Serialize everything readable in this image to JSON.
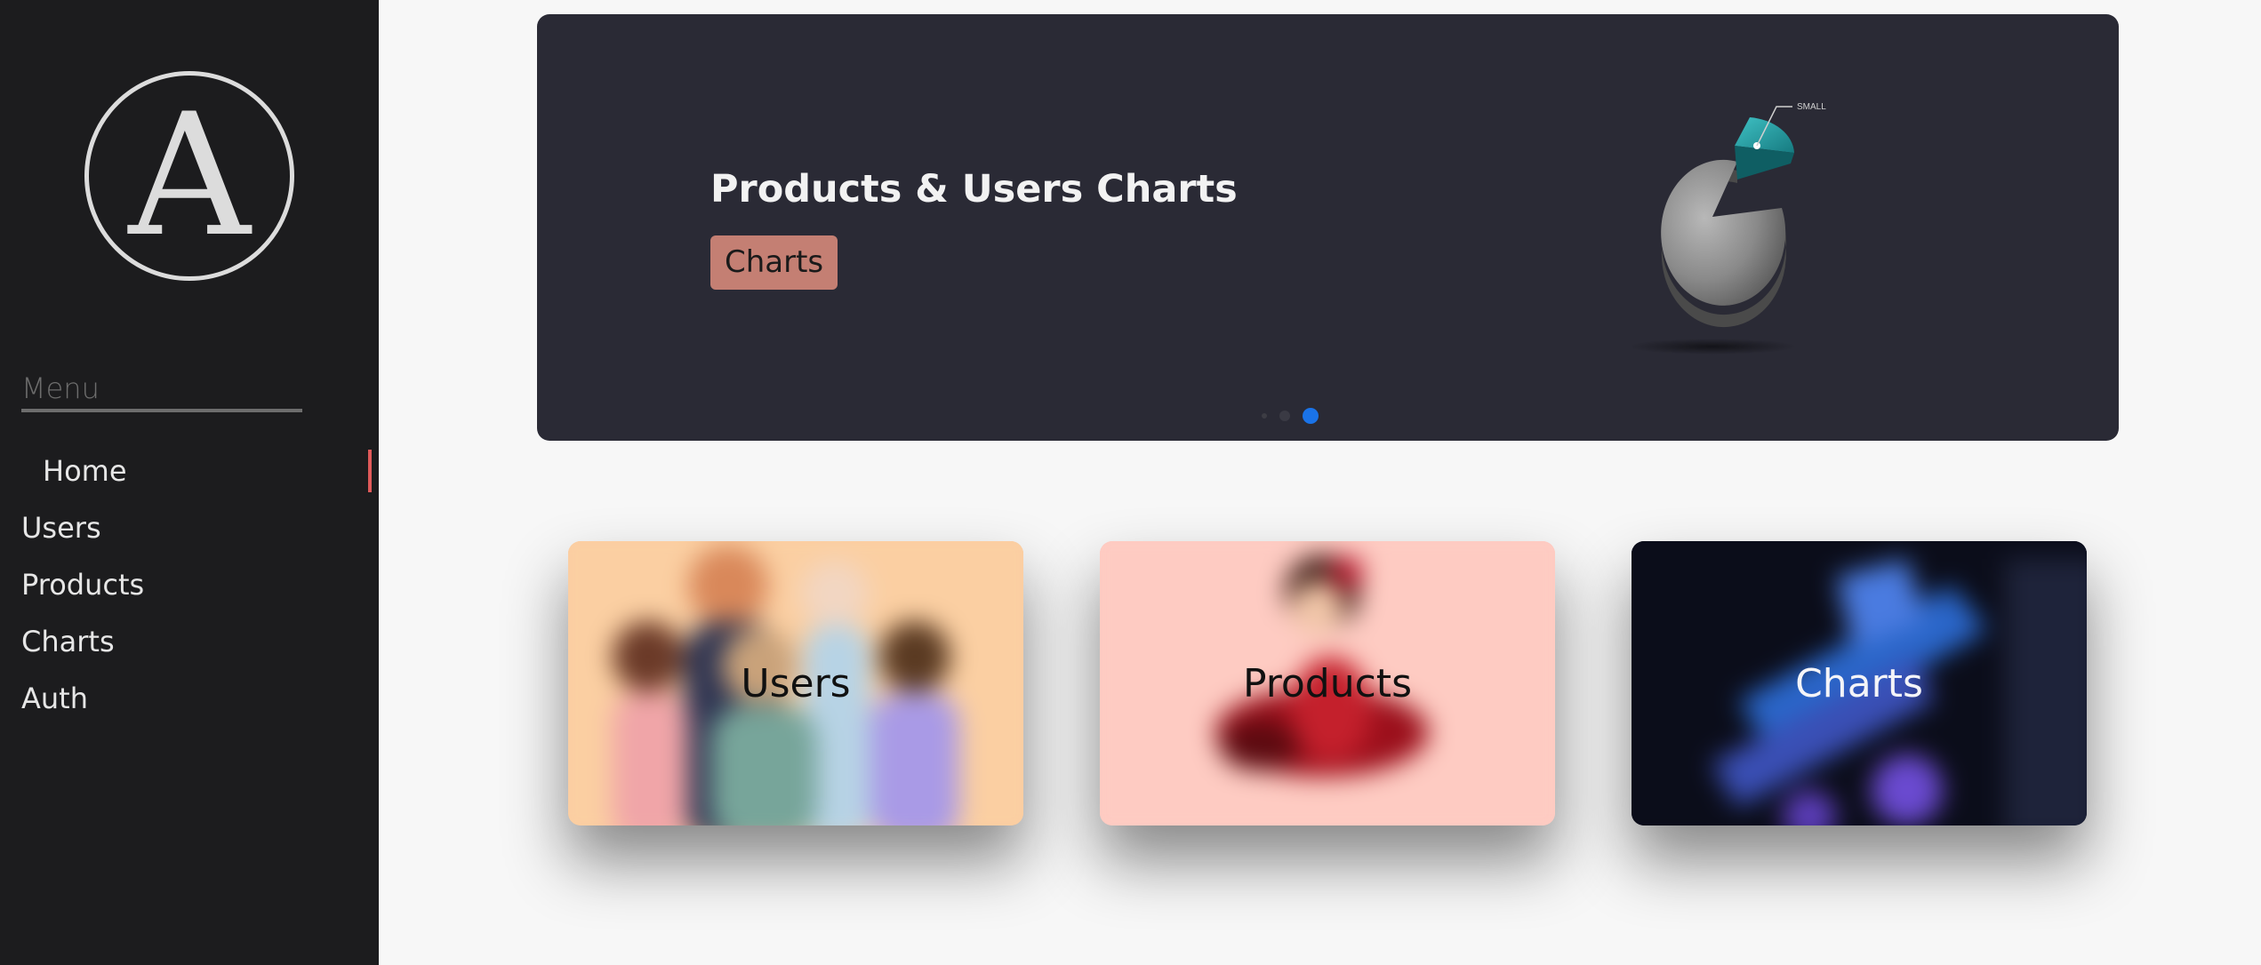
{
  "sidebar": {
    "logo_letter": "A",
    "menu_title": "Menu",
    "items": [
      {
        "label": "Home",
        "active": true
      },
      {
        "label": "Users",
        "active": false
      },
      {
        "label": "Products",
        "active": false
      },
      {
        "label": "Charts",
        "active": false
      },
      {
        "label": "Auth",
        "active": false
      }
    ]
  },
  "banner": {
    "title": "Products & Users Charts",
    "button_label": "Charts",
    "illustration": "pie-chart-icon",
    "illustration_tag": "SMALL",
    "slides_count": 3,
    "active_slide": 3
  },
  "cards": [
    {
      "label": "Users",
      "image": "people-group-illustration"
    },
    {
      "label": "Products",
      "image": "figure-illustration"
    },
    {
      "label": "Charts",
      "image": "abstract-blue-illustration"
    }
  ],
  "colors": {
    "sidebar_bg": "#1c1c1e",
    "banner_bg": "#2a2a35",
    "button_bg": "#c47f73",
    "active_indicator": "#e05a5a",
    "active_dot": "#1a73e8"
  }
}
